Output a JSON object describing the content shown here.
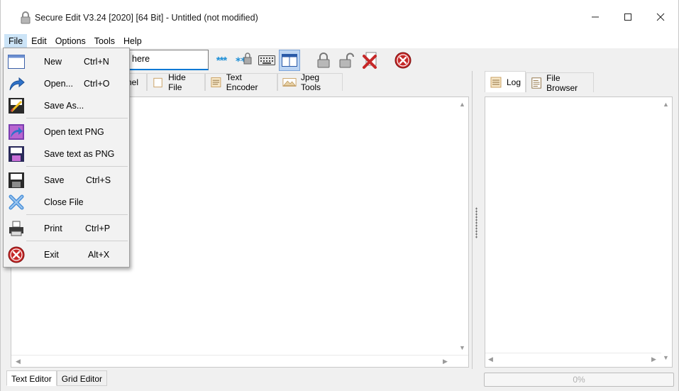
{
  "window": {
    "title": "Secure Edit V3.24 [2020] [64 Bit] - Untitled (not modified)"
  },
  "menubar": {
    "items": [
      "File",
      "Edit",
      "Options",
      "Tools",
      "Help"
    ]
  },
  "toolbar": {
    "password_hint": "here",
    "password_mask_label": "***"
  },
  "tabs": {
    "partial_label": "nel",
    "hide_file": "Hide File",
    "text_encoder": "Text Encoder",
    "jpeg_tools": "Jpeg Tools"
  },
  "bottom_tabs": {
    "text_editor": "Text Editor",
    "grid_editor": "Grid Editor"
  },
  "right_tabs": {
    "log": "Log",
    "file_browser": "File Browser"
  },
  "progress": {
    "value": 0,
    "label": "0%"
  },
  "file_menu": {
    "new": {
      "label": "New",
      "shortcut": "Ctrl+N"
    },
    "open": {
      "label": "Open...",
      "shortcut": "Ctrl+O"
    },
    "save_as": {
      "label": "Save As...",
      "shortcut": ""
    },
    "open_png": {
      "label": "Open text PNG",
      "shortcut": ""
    },
    "save_png": {
      "label": "Save text as PNG",
      "shortcut": ""
    },
    "save": {
      "label": "Save",
      "shortcut": "Ctrl+S"
    },
    "close": {
      "label": "Close File",
      "shortcut": ""
    },
    "print": {
      "label": "Print",
      "shortcut": "Ctrl+P"
    },
    "exit": {
      "label": "Exit",
      "shortcut": "Alt+X"
    }
  },
  "colors": {
    "accent": "#0078d4",
    "menu_highlight": "#cce4f7",
    "exit_red": "#c62828"
  }
}
